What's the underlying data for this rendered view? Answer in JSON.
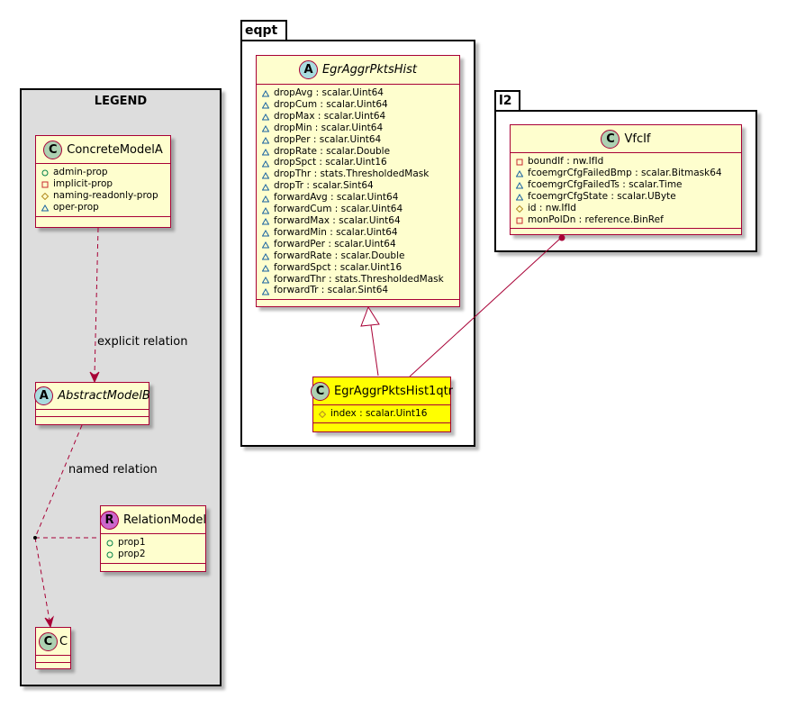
{
  "legend": {
    "title": "LEGEND",
    "concrete": {
      "stereotype": "C",
      "name": "ConcreteModelA",
      "attrs": [
        {
          "vis": "public",
          "text": "admin-prop"
        },
        {
          "vis": "private",
          "text": "implicit-prop"
        },
        {
          "vis": "protected",
          "text": "naming-readonly-prop"
        },
        {
          "vis": "package",
          "text": "oper-prop"
        }
      ]
    },
    "abstract": {
      "stereotype": "A",
      "name": "AbstractModelB"
    },
    "relation_model": {
      "stereotype": "R",
      "name": "RelationModel",
      "attrs": [
        {
          "vis": "public",
          "text": "prop1"
        },
        {
          "vis": "public",
          "text": "prop2"
        }
      ]
    },
    "c_class": {
      "stereotype": "C",
      "name": "C"
    },
    "explicit_label": "explicit relation",
    "named_label": "named relation"
  },
  "eqpt": {
    "package_name": "eqpt",
    "abstract_hist": {
      "stereotype": "A",
      "name": "EgrAggrPktsHist",
      "attrs": [
        {
          "vis": "package",
          "text": "dropAvg : scalar.Uint64"
        },
        {
          "vis": "package",
          "text": "dropCum : scalar.Uint64"
        },
        {
          "vis": "package",
          "text": "dropMax : scalar.Uint64"
        },
        {
          "vis": "package",
          "text": "dropMin : scalar.Uint64"
        },
        {
          "vis": "package",
          "text": "dropPer : scalar.Uint64"
        },
        {
          "vis": "package",
          "text": "dropRate : scalar.Double"
        },
        {
          "vis": "package",
          "text": "dropSpct : scalar.Uint16"
        },
        {
          "vis": "package",
          "text": "dropThr : stats.ThresholdedMask"
        },
        {
          "vis": "package",
          "text": "dropTr : scalar.Sint64"
        },
        {
          "vis": "package",
          "text": "forwardAvg : scalar.Uint64"
        },
        {
          "vis": "package",
          "text": "forwardCum : scalar.Uint64"
        },
        {
          "vis": "package",
          "text": "forwardMax : scalar.Uint64"
        },
        {
          "vis": "package",
          "text": "forwardMin : scalar.Uint64"
        },
        {
          "vis": "package",
          "text": "forwardPer : scalar.Uint64"
        },
        {
          "vis": "package",
          "text": "forwardRate : scalar.Double"
        },
        {
          "vis": "package",
          "text": "forwardSpct : scalar.Uint16"
        },
        {
          "vis": "package",
          "text": "forwardThr : stats.ThresholdedMask"
        },
        {
          "vis": "package",
          "text": "forwardTr : scalar.Sint64"
        }
      ]
    },
    "hist_1qtr": {
      "stereotype": "C",
      "name": "EgrAggrPktsHist1qtr",
      "attrs": [
        {
          "vis": "protected",
          "text": "index : scalar.Uint16"
        }
      ]
    }
  },
  "l2": {
    "package_name": "l2",
    "vfcif": {
      "stereotype": "C",
      "name": "VfcIf",
      "attrs": [
        {
          "vis": "private",
          "text": "boundIf : nw.IfId"
        },
        {
          "vis": "package",
          "text": "fcoemgrCfgFailedBmp : scalar.Bitmask64"
        },
        {
          "vis": "package",
          "text": "fcoemgrCfgFailedTs : scalar.Time"
        },
        {
          "vis": "package",
          "text": "fcoemgrCfgState : scalar.UByte"
        },
        {
          "vis": "protected",
          "text": "id : nw.IfId"
        },
        {
          "vis": "private",
          "text": "monPolDn : reference.BinRef"
        }
      ]
    }
  },
  "colors": {
    "class_fill": "#fefece",
    "class_border": "#a80036",
    "highlight_fill": "#ffff00",
    "legend_fill": "#dddddd"
  }
}
